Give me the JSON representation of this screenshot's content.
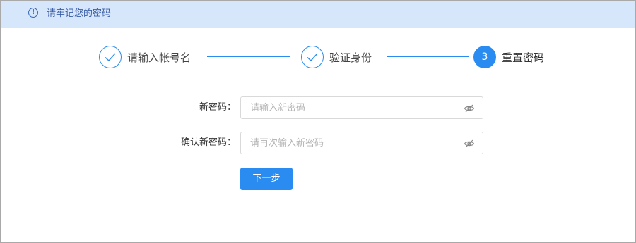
{
  "notice": {
    "icon": "info-icon",
    "icon_glyph": "!",
    "text": "请牢记您的密码"
  },
  "steps": [
    {
      "label": "请输入帐号名",
      "status": "done",
      "icon": "check-icon"
    },
    {
      "label": "验证身份",
      "status": "done",
      "icon": "check-icon"
    },
    {
      "label": "重置密码",
      "status": "active",
      "number": "3"
    }
  ],
  "form": {
    "new_password": {
      "label": "新密码：",
      "placeholder": "请输入新密码",
      "value": "",
      "toggle_icon": "eye-slash-icon"
    },
    "confirm_password": {
      "label": "确认新密码：",
      "placeholder": "请再次输入新密码",
      "value": "",
      "toggle_icon": "eye-slash-icon"
    },
    "submit_label": "下一步"
  },
  "colors": {
    "accent": "#2a8cf0",
    "notice_bg": "#d6e6fb",
    "notice_text": "#3a5ea8"
  }
}
